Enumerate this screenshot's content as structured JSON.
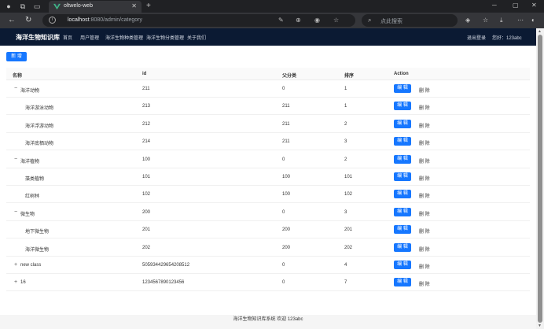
{
  "browser": {
    "tab_title": "oltwelo-web",
    "url_host": "localhost",
    "url_rest": ":8080/admin/category",
    "search_placeholder": "点此搜索"
  },
  "header": {
    "brand": "海洋生物知识库",
    "nav": [
      "首页",
      "用户管理",
      "海洋生物种类管理",
      "海洋生物分类管理",
      "关于我们"
    ],
    "logout": "退出登录",
    "greeting": "您好：123abc"
  },
  "toolbar": {
    "add_label": "新 增"
  },
  "table": {
    "headers": [
      "名称",
      "id",
      "父分类",
      "排序",
      "Action"
    ],
    "edit_label": "编 辑",
    "delete_label": "删 除",
    "rows": [
      {
        "name": "海洋动物",
        "expander": "−",
        "id": "211",
        "parent": "0",
        "sort": "1"
      },
      {
        "name": "海洋游泳动物",
        "expander": "",
        "id": "213",
        "parent": "211",
        "sort": "1"
      },
      {
        "name": "海洋浮游动物",
        "expander": "",
        "id": "212",
        "parent": "211",
        "sort": "2"
      },
      {
        "name": "海洋底栖动物",
        "expander": "",
        "id": "214",
        "parent": "211",
        "sort": "3"
      },
      {
        "name": "海洋植物",
        "expander": "−",
        "id": "100",
        "parent": "0",
        "sort": "2"
      },
      {
        "name": "藻类植物",
        "expander": "",
        "id": "101",
        "parent": "100",
        "sort": "101"
      },
      {
        "name": "红树林",
        "expander": "",
        "id": "102",
        "parent": "100",
        "sort": "102"
      },
      {
        "name": "微生物",
        "expander": "−",
        "id": "200",
        "parent": "0",
        "sort": "3"
      },
      {
        "name": "地下微生物",
        "expander": "",
        "id": "201",
        "parent": "200",
        "sort": "201"
      },
      {
        "name": "海洋微生物",
        "expander": "",
        "id": "202",
        "parent": "200",
        "sort": "202"
      },
      {
        "name": "new class",
        "expander": "+",
        "id": "505934429654208512",
        "parent": "0",
        "sort": "4"
      },
      {
        "name": "16",
        "expander": "+",
        "id": "1234567890123456",
        "parent": "0",
        "sort": "7"
      }
    ]
  },
  "footer": {
    "text": "海洋生物知识库系统 欢迎 123abc"
  },
  "colors": {
    "primary": "#1677ff",
    "header_bg": "#0b1a33"
  }
}
